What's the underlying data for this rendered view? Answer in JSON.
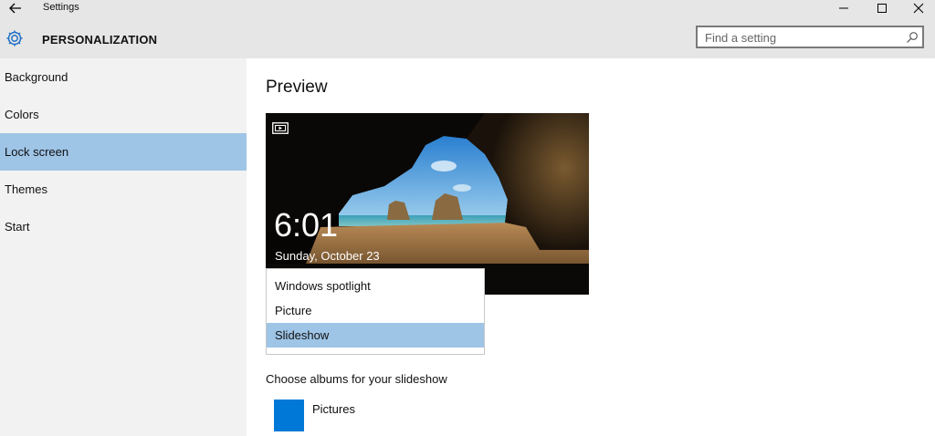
{
  "window": {
    "title": "Settings",
    "back_icon": "back-arrow-icon",
    "controls": [
      "minimize-icon",
      "maximize-icon",
      "close-icon"
    ]
  },
  "header": {
    "title": "PERSONALIZATION",
    "icon": "gear-icon",
    "search_placeholder": "Find a setting",
    "search_icon": "search-icon"
  },
  "sidebar": {
    "items": [
      {
        "label": "Background"
      },
      {
        "label": "Colors"
      },
      {
        "label": "Lock screen",
        "active": true
      },
      {
        "label": "Themes"
      },
      {
        "label": "Start"
      }
    ]
  },
  "main": {
    "preview_title": "Preview",
    "preview": {
      "time": "6:01",
      "date": "Sunday, October 23",
      "icon": "slideshow-icon"
    },
    "background_dropdown": {
      "options": [
        {
          "label": "Windows spotlight"
        },
        {
          "label": "Picture"
        },
        {
          "label": "Slideshow",
          "selected": true
        }
      ]
    },
    "albums_label": "Choose albums for your slideshow",
    "albums": [
      {
        "name": "Pictures"
      }
    ]
  },
  "colors": {
    "accent": "#0078d7",
    "selection": "#9ec4e6",
    "sidebar_bg": "#f2f2f2",
    "header_bg": "#e6e6e6"
  }
}
